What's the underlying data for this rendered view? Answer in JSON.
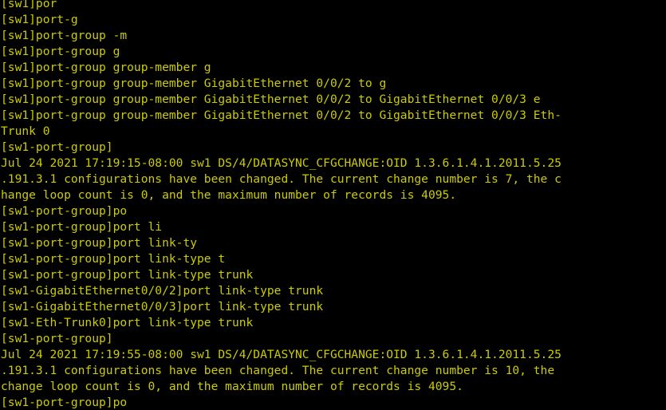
{
  "terminal": {
    "window_title": "Terminal",
    "background_color": "#000000",
    "foreground_color": "#cccc00",
    "device_name": "sw1",
    "columns": 82,
    "rows": 26,
    "cursor": {
      "visible": false,
      "line_index": 25,
      "column": 22
    },
    "prompts": {
      "system_view": "[sw1]",
      "port_group_view": "[sw1-port-group]",
      "gigabitethernet_0_0_2_view": "[sw1-GigabitEthernet0/0/2]",
      "gigabitethernet_0_0_3_view": "[sw1-GigabitEthernet0/0/3]",
      "eth_trunk_0_view": "[sw1-Eth-Trunk0]"
    },
    "lines": [
      "[sw1]por",
      "[sw1]port-g",
      "[sw1]port-group -m",
      "[sw1]port-group g",
      "[sw1]port-group group-member g",
      "[sw1]port-group group-member GigabitEthernet 0/0/2 to g",
      "[sw1]port-group group-member GigabitEthernet 0/0/2 to GigabitEthernet 0/0/3 e",
      "[sw1]port-group group-member GigabitEthernet 0/0/2 to GigabitEthernet 0/0/3 Eth-",
      "Trunk 0",
      "[sw1-port-group]",
      "Jul 24 2021 17:19:15-08:00 sw1 DS/4/DATASYNC_CFGCHANGE:OID 1.3.6.1.4.1.2011.5.25",
      ".191.3.1 configurations have been changed. The current change number is 7, the c",
      "hange loop count is 0, and the maximum number of records is 4095.",
      "[sw1-port-group]po",
      "[sw1-port-group]port li",
      "[sw1-port-group]port link-ty",
      "[sw1-port-group]port link-type t",
      "[sw1-port-group]port link-type trunk",
      "[sw1-GigabitEthernet0/0/2]port link-type trunk",
      "[sw1-GigabitEthernet0/0/3]port link-type trunk",
      "[sw1-Eth-Trunk0]port link-type trunk",
      "[sw1-port-group]",
      "Jul 24 2021 17:19:55-08:00 sw1 DS/4/DATASYNC_CFGCHANGE:OID 1.3.6.1.4.1.2011.5.25",
      ".191.3.1 configurations have been changed. The current change number is 10, the",
      "change loop count is 0, and the maximum number of records is 4095.",
      "[sw1-port-group]po"
    ],
    "log_messages": [
      {
        "timestamp": "Jul 24 2021 17:19:15-08:00",
        "host": "sw1",
        "facility": "DS/4/DATASYNC_CFGCHANGE",
        "oid": "1.3.6.1.4.1.2011.5.25.191.3.1",
        "change_number": "7",
        "change_loop_count": "0",
        "max_records": "4095"
      },
      {
        "timestamp": "Jul 24 2021 17:19:55-08:00",
        "host": "sw1",
        "facility": "DS/4/DATASYNC_CFGCHANGE",
        "oid": "1.3.6.1.4.1.2011.5.25.191.3.1",
        "change_number": "10",
        "change_loop_count": "0",
        "max_records": "4095"
      }
    ]
  }
}
